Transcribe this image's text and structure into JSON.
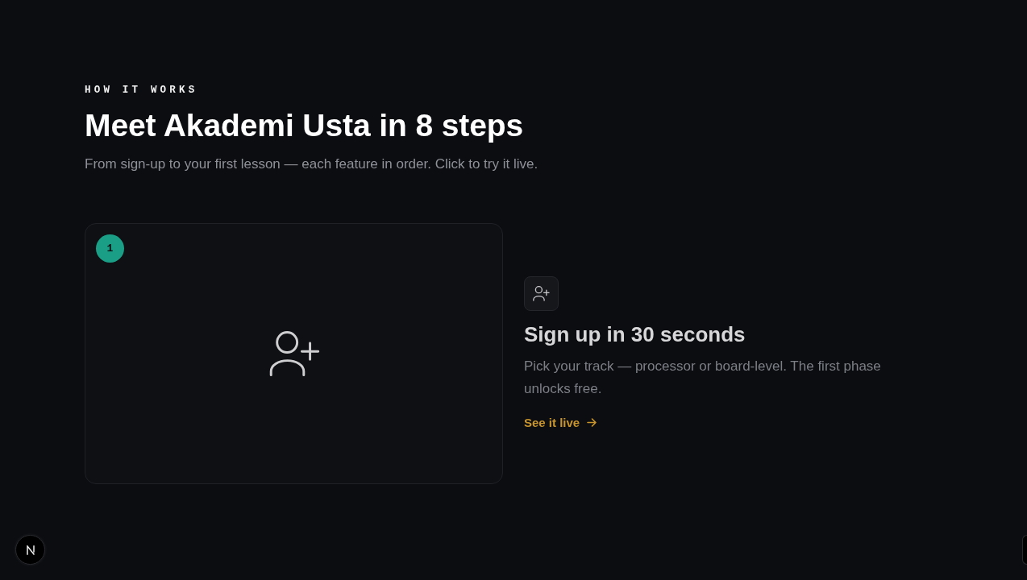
{
  "section": {
    "eyebrow": "HOW IT WORKS",
    "title": "Meet Akademi Usta in 8 steps",
    "subtitle": "From sign-up to your first lesson — each feature in order. Click to try it live."
  },
  "steps": [
    {
      "number": "1",
      "title": "Sign up in 30 seconds",
      "description": "Pick your track — processor or board-level. The first phase unlocks free.",
      "link": "See it live"
    }
  ]
}
